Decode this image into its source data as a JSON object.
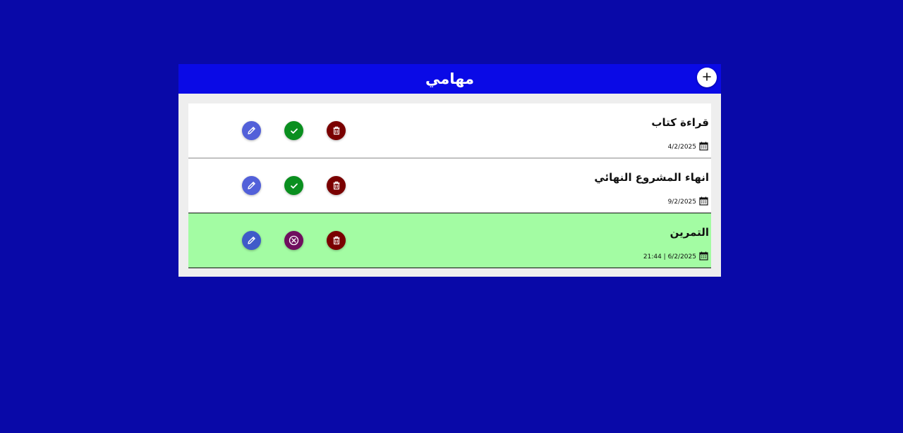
{
  "header": {
    "title": "مهامي",
    "add_icon": "plus-icon",
    "color": "#0a0ae6"
  },
  "colors": {
    "page_background": "#0909a8",
    "panel_background": "#eeeeee",
    "edit_button": "#5260d9",
    "complete_button": "#0a8f1f",
    "undo_button": "#6f0e5e",
    "delete_button": "#7a0000",
    "done_row": "#a3fca3"
  },
  "tasks": [
    {
      "title": "قراءة كتاب",
      "date": "4/2/2025",
      "completed": false,
      "actions": [
        "edit-icon",
        "check-icon",
        "trash-icon"
      ]
    },
    {
      "title": "انهاء المشروع النهائي",
      "date": "9/2/2025",
      "completed": false,
      "actions": [
        "edit-icon",
        "check-icon",
        "trash-icon"
      ]
    },
    {
      "title": "التمرين",
      "date": "21:44 | 6/2/2025",
      "completed": true,
      "actions": [
        "edit-icon",
        "x-circle-icon",
        "trash-icon"
      ]
    }
  ]
}
